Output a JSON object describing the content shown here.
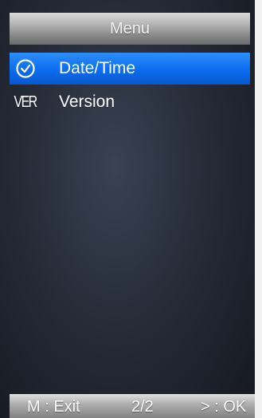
{
  "menu": {
    "title": "Menu",
    "items": [
      {
        "label": "Date/Time",
        "icon": "clock-icon",
        "selected": true
      },
      {
        "label": "Version",
        "icon_text": "VER",
        "icon": "version-icon",
        "selected": false
      }
    ]
  },
  "status_bar": {
    "exit_hint": "M : Exit",
    "page": "2/2",
    "ok_hint": "> : OK"
  },
  "colors": {
    "selection": "#0d6ff0",
    "background": "#262c38",
    "title_bar": "#9a9a9a"
  }
}
